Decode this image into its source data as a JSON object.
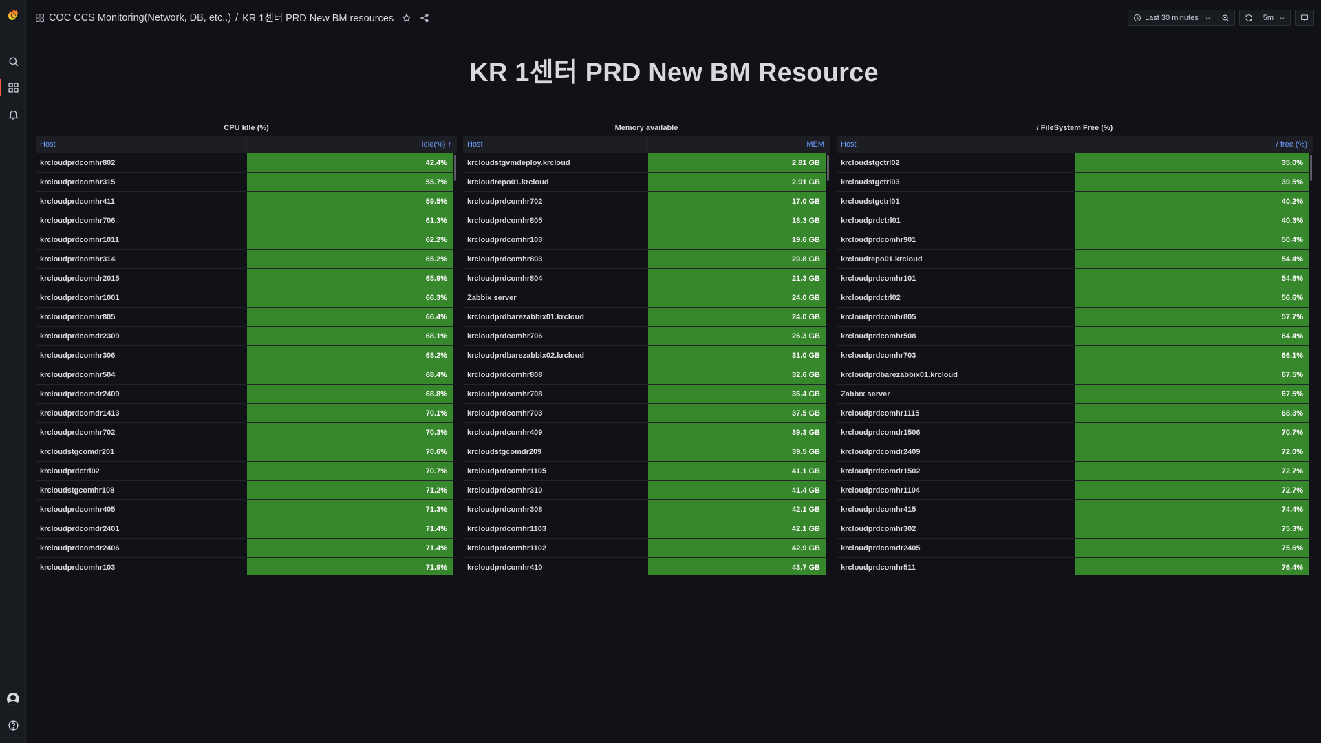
{
  "app": {
    "breadcrumb_folder": "COC CCS Monitoring(Network, DB, etc..)",
    "breadcrumb_sep": "/",
    "breadcrumb_dashboard": "KR 1센터 PRD New BM resources"
  },
  "sidebar": {
    "items": [
      {
        "name": "grafana-logo-icon"
      },
      {
        "name": "search-icon"
      },
      {
        "name": "dashboards-icon",
        "active": true
      },
      {
        "name": "alerting-bell-icon"
      },
      {
        "name": "user-avatar-icon"
      },
      {
        "name": "help-icon"
      }
    ]
  },
  "toolbar": {
    "time_range": "Last 30 minutes",
    "refresh_interval": "5m"
  },
  "dashboard": {
    "title": "KR 1센터 PRD New BM Resource"
  },
  "colors": {
    "cell_green": "#37872d",
    "header_link": "#6e9fff",
    "accent": "#f55f3e",
    "background": "#111217"
  },
  "panels": [
    {
      "title": "CPU Idle (%)",
      "col_host": "Host",
      "col_value": "Idle(%) ↑",
      "rows": [
        [
          "krcloudprdcomhr802",
          "42.4%"
        ],
        [
          "krcloudprdcomhr315",
          "55.7%"
        ],
        [
          "krcloudprdcomhr411",
          "59.5%"
        ],
        [
          "krcloudprdcomhr706",
          "61.3%"
        ],
        [
          "krcloudprdcomhr1011",
          "62.2%"
        ],
        [
          "krcloudprdcomhr314",
          "65.2%"
        ],
        [
          "krcloudprdcomdr2015",
          "65.9%"
        ],
        [
          "krcloudprdcomhr1001",
          "66.3%"
        ],
        [
          "krcloudprdcomhr805",
          "66.4%"
        ],
        [
          "krcloudprdcomdr2309",
          "68.1%"
        ],
        [
          "krcloudprdcomhr306",
          "68.2%"
        ],
        [
          "krcloudprdcomhr504",
          "68.4%"
        ],
        [
          "krcloudprdcomdr2409",
          "68.8%"
        ],
        [
          "krcloudprdcomdr1413",
          "70.1%"
        ],
        [
          "krcloudprdcomhr702",
          "70.3%"
        ],
        [
          "krcloudstgcomdr201",
          "70.6%"
        ],
        [
          "krcloudprdctrl02",
          "70.7%"
        ],
        [
          "krcloudstgcomhr108",
          "71.2%"
        ],
        [
          "krcloudprdcomhr405",
          "71.3%"
        ],
        [
          "krcloudprdcomdr2401",
          "71.4%"
        ],
        [
          "krcloudprdcomdr2406",
          "71.4%"
        ],
        [
          "krcloudprdcomhr103",
          "71.9%"
        ]
      ]
    },
    {
      "title": "Memory available",
      "col_host": "Host",
      "col_value": "MEM",
      "rows": [
        [
          "krcloudstgvmdeploy.krcloud",
          "2.81 GB"
        ],
        [
          "krcloudrepo01.krcloud",
          "2.91 GB"
        ],
        [
          "krcloudprdcomhr702",
          "17.0 GB"
        ],
        [
          "krcloudprdcomhr805",
          "18.3 GB"
        ],
        [
          "krcloudprdcomhr103",
          "19.6 GB"
        ],
        [
          "krcloudprdcomhr803",
          "20.8 GB"
        ],
        [
          "krcloudprdcomhr804",
          "21.3 GB"
        ],
        [
          "Zabbix server",
          "24.0 GB"
        ],
        [
          "krcloudprdbarezabbix01.krcloud",
          "24.0 GB"
        ],
        [
          "krcloudprdcomhr706",
          "26.3 GB"
        ],
        [
          "krcloudprdbarezabbix02.krcloud",
          "31.0 GB"
        ],
        [
          "krcloudprdcomhr808",
          "32.6 GB"
        ],
        [
          "krcloudprdcomhr708",
          "36.4 GB"
        ],
        [
          "krcloudprdcomhr703",
          "37.5 GB"
        ],
        [
          "krcloudprdcomhr409",
          "39.3 GB"
        ],
        [
          "krcloudstgcomdr209",
          "39.5 GB"
        ],
        [
          "krcloudprdcomhr1105",
          "41.1 GB"
        ],
        [
          "krcloudprdcomhr310",
          "41.4 GB"
        ],
        [
          "krcloudprdcomhr308",
          "42.1 GB"
        ],
        [
          "krcloudprdcomhr1103",
          "42.1 GB"
        ],
        [
          "krcloudprdcomhr1102",
          "42.9 GB"
        ],
        [
          "krcloudprdcomhr410",
          "43.7 GB"
        ]
      ]
    },
    {
      "title": "/ FileSystem Free (%)",
      "col_host": "Host",
      "col_value": "/ free (%)",
      "rows": [
        [
          "krcloudstgctrl02",
          "35.0%"
        ],
        [
          "krcloudstgctrl03",
          "39.5%"
        ],
        [
          "krcloudstgctrl01",
          "40.2%"
        ],
        [
          "krcloudprdctrl01",
          "40.3%"
        ],
        [
          "krcloudprdcomhr901",
          "50.4%"
        ],
        [
          "krcloudrepo01.krcloud",
          "54.4%"
        ],
        [
          "krcloudprdcomhr101",
          "54.8%"
        ],
        [
          "krcloudprdctrl02",
          "56.6%"
        ],
        [
          "krcloudprdcomhr805",
          "57.7%"
        ],
        [
          "krcloudprdcomhr508",
          "64.4%"
        ],
        [
          "krcloudprdcomhr703",
          "66.1%"
        ],
        [
          "krcloudprdbarezabbix01.krcloud",
          "67.5%"
        ],
        [
          "Zabbix server",
          "67.5%"
        ],
        [
          "krcloudprdcomhr1115",
          "68.3%"
        ],
        [
          "krcloudprdcomdr1506",
          "70.7%"
        ],
        [
          "krcloudprdcomdr2409",
          "72.0%"
        ],
        [
          "krcloudprdcomdr1502",
          "72.7%"
        ],
        [
          "krcloudprdcomhr1104",
          "72.7%"
        ],
        [
          "krcloudprdcomhr415",
          "74.4%"
        ],
        [
          "krcloudprdcomhr302",
          "75.3%"
        ],
        [
          "krcloudprdcomdr2405",
          "75.6%"
        ],
        [
          "krcloudprdcomhr511",
          "76.4%"
        ]
      ]
    }
  ]
}
